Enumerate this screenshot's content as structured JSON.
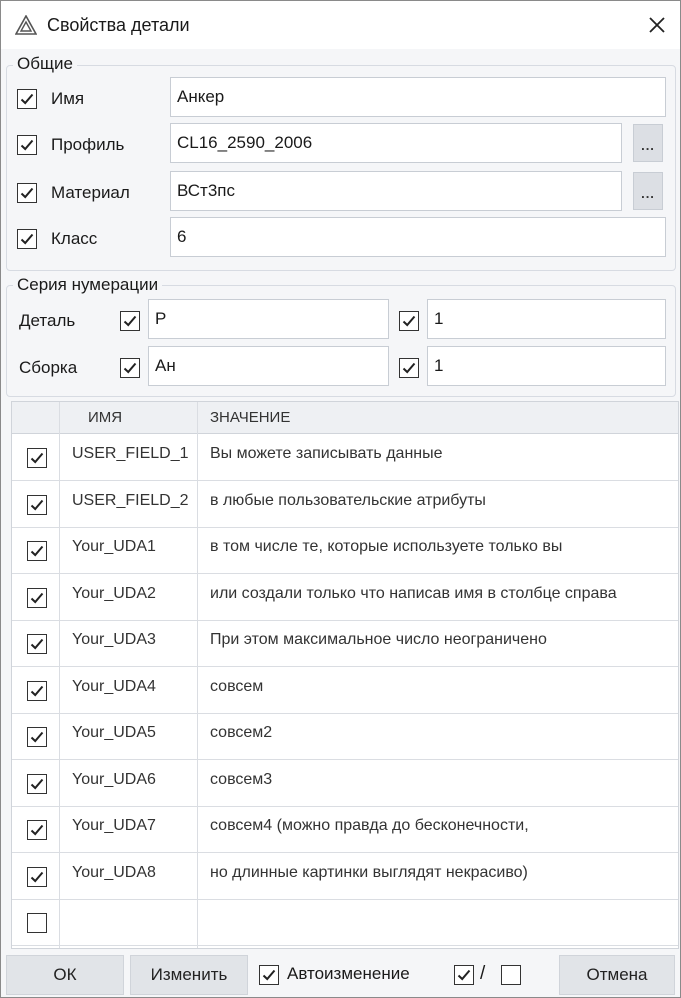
{
  "window": {
    "title": "Свойства детали",
    "app_icon": "triangle-logo-icon",
    "close_icon": "close-icon"
  },
  "general": {
    "legend": "Общие",
    "fields": [
      {
        "label": "Имя",
        "checked": true,
        "value": "Анкер",
        "has_browse": false
      },
      {
        "label": "Профиль",
        "checked": true,
        "value": "CL16_2590_2006",
        "has_browse": true
      },
      {
        "label": "Материал",
        "checked": true,
        "value": "ВСт3пс",
        "has_browse": true
      },
      {
        "label": "Класс",
        "checked": true,
        "value": "6",
        "has_browse": false
      }
    ],
    "browse_label": "..."
  },
  "numbering": {
    "legend": "Серия нумерации",
    "rows": [
      {
        "label": "Деталь",
        "prefix_checked": true,
        "prefix": "Р",
        "start_checked": true,
        "start": "1"
      },
      {
        "label": "Сборка",
        "prefix_checked": true,
        "prefix": "Ан",
        "start_checked": true,
        "start": "1"
      }
    ]
  },
  "attributes": {
    "columns": [
      "ИМЯ",
      "ЗНАЧЕНИЕ"
    ],
    "rows": [
      {
        "checked": true,
        "name": "USER_FIELD_1",
        "value": "Вы можете записывать данные"
      },
      {
        "checked": true,
        "name": "USER_FIELD_2",
        "value": "в любые пользовательские атрибуты"
      },
      {
        "checked": true,
        "name": "Your_UDA1",
        "value": "в том числе те, которые используете только вы"
      },
      {
        "checked": true,
        "name": "Your_UDA2",
        "value": "или создали только что написав имя в столбце справа"
      },
      {
        "checked": true,
        "name": "Your_UDA3",
        "value": "При этом максимальное число неограничено"
      },
      {
        "checked": true,
        "name": "Your_UDA4",
        "value": "совсем"
      },
      {
        "checked": true,
        "name": "Your_UDA5",
        "value": "совсем2"
      },
      {
        "checked": true,
        "name": "Your_UDA6",
        "value": "совсем3"
      },
      {
        "checked": true,
        "name": "Your_UDA7",
        "value": "совсем4 (можно правда до бесконечности,"
      },
      {
        "checked": true,
        "name": "Your_UDA8",
        "value": "но длинные картинки выглядят некрасиво)"
      },
      {
        "checked": false,
        "name": "",
        "value": ""
      }
    ]
  },
  "footer": {
    "ok_label": "ОК",
    "modify_label": "Изменить",
    "auto_label": "Автоизменение",
    "auto_checked": true,
    "toggle_separator": "/",
    "cancel_label": "Отмена"
  }
}
